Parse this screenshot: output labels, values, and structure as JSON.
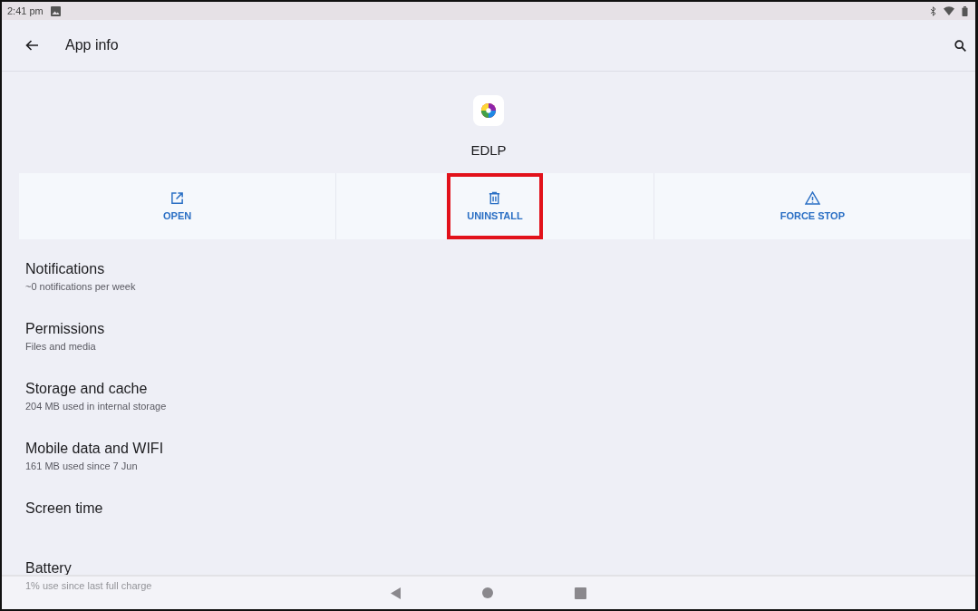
{
  "status_bar": {
    "time": "2:41 pm"
  },
  "app_bar": {
    "title": "App info"
  },
  "app": {
    "name": "EDLP"
  },
  "actions": [
    {
      "kind": "open",
      "label": "OPEN",
      "highlighted": false
    },
    {
      "kind": "uninstall",
      "label": "UNINSTALL",
      "highlighted": true
    },
    {
      "kind": "force_stop",
      "label": "FORCE STOP",
      "highlighted": false
    }
  ],
  "settings": [
    {
      "title": "Notifications",
      "subtitle": "~0 notifications per week"
    },
    {
      "title": "Permissions",
      "subtitle": "Files and media"
    },
    {
      "title": "Storage and cache",
      "subtitle": "204 MB used in internal storage"
    },
    {
      "title": "Mobile data and WIFI",
      "subtitle": "161 MB used since 7 Jun"
    },
    {
      "title": "Screen time"
    },
    {
      "title": "Battery",
      "subtitle": "1% use since last full charge"
    }
  ]
}
